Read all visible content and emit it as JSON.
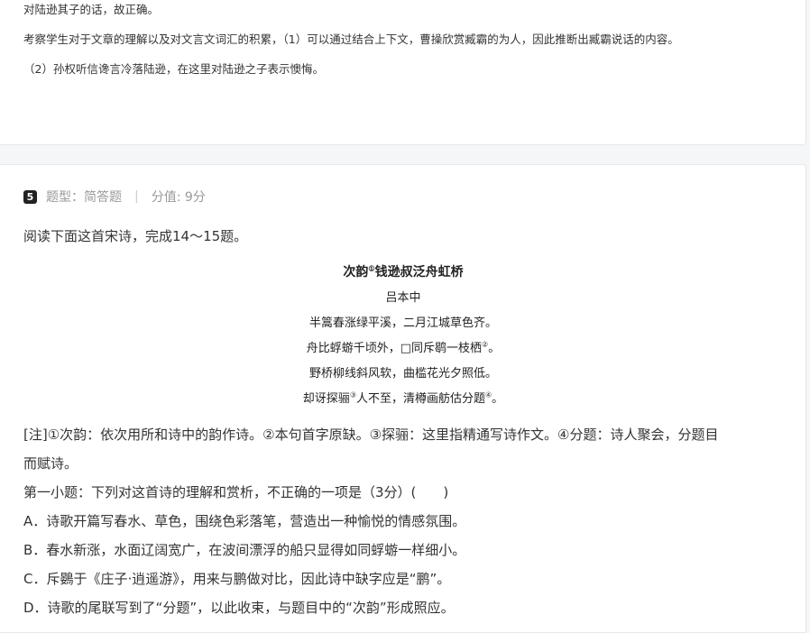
{
  "prev_card": {
    "line1": "对陆逊其子的话，故正确。",
    "line2": "考察学生对于文章的理解以及对文言文词汇的积累，（1）可以通过结合上下文，曹操欣赏臧霸的为人，因此推断出臧霸说话的内容。",
    "line3": "（2）孙权听信谗言冷落陆逊，在这里对陆逊之子表示懊悔。"
  },
  "question": {
    "number": "5",
    "type_label": "题型：简答题",
    "separator": "|",
    "score_label": "分值: 9分",
    "intro": "阅读下面这首宋诗，完成14～15题。",
    "poem": {
      "title_a": "次韵",
      "title_note": "①",
      "title_b": "钱逊叔泛舟虹桥",
      "author": "吕本中",
      "l1": "半篙春涨绿平溪，二月江城草色齐。",
      "l2a": "舟比蜉蝣千顷外，□同斥鹖一枝栖",
      "l2note": "②",
      "l2b": "。",
      "l3": "野桥柳线斜风软，曲槛花光夕照低。",
      "l4a": "却讶探骊",
      "l4note1": "③",
      "l4b": "人不至，清樽画舫估分题",
      "l4note2": "④",
      "l4c": "。"
    },
    "note_line1": "[注]①次韵：依次用所和诗中的韵作诗。②本句首字原缺。③探骊：这里指精通写诗作文。④分题：诗人聚会，分题目",
    "note_line2": "而赋诗。",
    "sub1": "第一小题：下列对这首诗的理解和赏析，不正确的一项是（3分）(　　)",
    "optA": "A．诗歌开篇写春水、草色，围绕色彩落笔，营造出一种愉悦的情感氛围。",
    "optB": "B．春水新涨，水面辽阔宽广，在波间漂浮的船只显得如同蜉蝣一样细小。",
    "optC": "C．斥鷃于《庄子·逍遥游》，用来与鹏做对比，因此诗中缺字应是“鹏”。",
    "optD": "D．诗歌的尾联写到了“分题”，以此收束，与题目中的“次韵”形成照应。"
  }
}
